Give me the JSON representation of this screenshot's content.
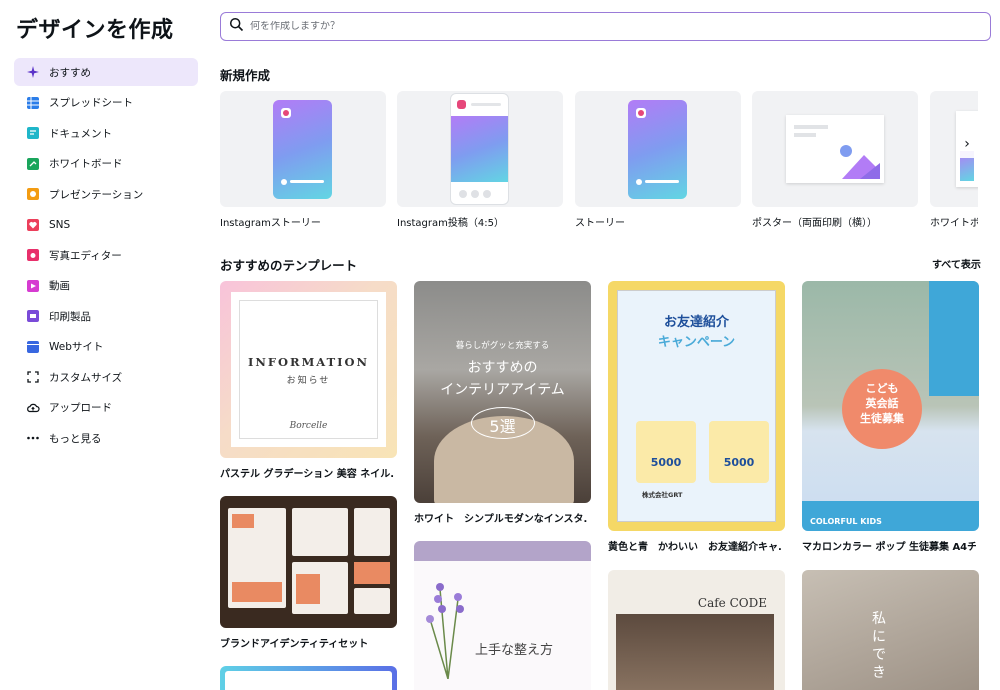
{
  "app_title": "デザインを作成",
  "sidebar": {
    "items": [
      {
        "label": "おすすめ",
        "icon": "sparkle-icon",
        "active": true
      },
      {
        "label": "スプレッドシート",
        "icon": "spreadsheet-icon"
      },
      {
        "label": "ドキュメント",
        "icon": "document-icon"
      },
      {
        "label": "ホワイトボード",
        "icon": "whiteboard-icon"
      },
      {
        "label": "プレゼンテーション",
        "icon": "presentation-icon"
      },
      {
        "label": "SNS",
        "icon": "heart-icon"
      },
      {
        "label": "写真エディター",
        "icon": "camera-icon"
      },
      {
        "label": "動画",
        "icon": "video-icon"
      },
      {
        "label": "印刷製品",
        "icon": "printer-icon"
      },
      {
        "label": "Webサイト",
        "icon": "website-icon"
      },
      {
        "label": "カスタムサイズ",
        "icon": "custom-size-icon"
      },
      {
        "label": "アップロード",
        "icon": "upload-cloud-icon"
      },
      {
        "label": "もっと見る",
        "icon": "more-dots-icon"
      }
    ]
  },
  "search": {
    "placeholder": "何を作成しますか？"
  },
  "new_section": {
    "title": "新規作成",
    "items": [
      {
        "label": "Instagramストーリー"
      },
      {
        "label": "Instagram投稿（4:5）"
      },
      {
        "label": "ストーリー"
      },
      {
        "label": "ポスター（両面印刷（横））"
      },
      {
        "label": "ホワイトボ"
      }
    ]
  },
  "templates_section": {
    "title": "おすすめのテンプレート",
    "see_all": "すべて表示",
    "cards": [
      {
        "label": "パステル グラデーション 美容 ネイル..."
      },
      {
        "label": "ホワイト　シンプルモダンなインスタ..."
      },
      {
        "label": "黄色と青　かわいい　お友達紹介キャ..."
      },
      {
        "label": "マカロンカラー ポップ 生徒募集 A4チ..."
      },
      {
        "label": "ブランドアイデンティティセット"
      }
    ]
  },
  "thumbs": {
    "pastel": {
      "title": "INFORMATION",
      "sub": "お知らせ",
      "brand": "Borcelle"
    },
    "interior": {
      "line1": "暮らしがグッと充実する",
      "line2": "おすすめの",
      "line3": "インテリアアイテム",
      "num": "5選"
    },
    "friend": {
      "title": "お友達紹介",
      "sub": "キャンペーン",
      "amount1": "5000",
      "amount2": "5000",
      "company": "株式会社GRT"
    },
    "kids": {
      "title1": "こども",
      "title2": "英会話",
      "title3": "生徒募集",
      "bottom": "COLORFUL KIDS"
    },
    "cafe": {
      "title": "Cafe CODE"
    },
    "lavender": {
      "text": "上手な整え方"
    },
    "seasoning": {
      "text": "私にでき"
    }
  }
}
